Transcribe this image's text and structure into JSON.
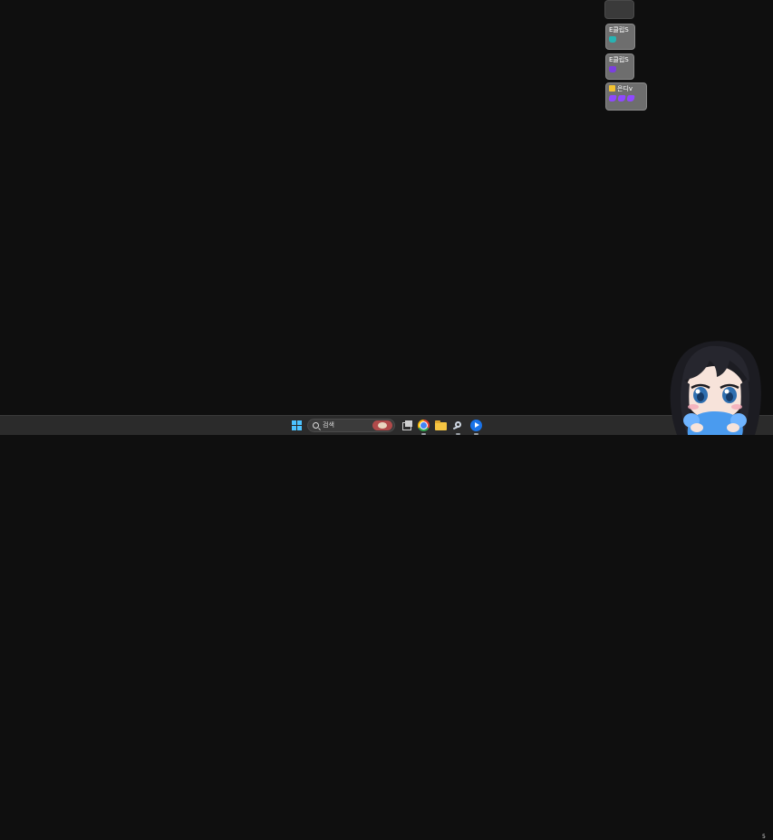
{
  "overlay": {
    "badges": [
      {
        "label": "",
        "gems": []
      },
      {
        "label": "E클립S",
        "gems": [
          "teal"
        ]
      },
      {
        "label": "E클립S",
        "gems": [
          "purple"
        ]
      },
      {
        "label": "은디v",
        "gems": [
          "violet",
          "violet",
          "violet"
        ]
      }
    ]
  },
  "taskbar": {
    "search": {
      "label": "검색"
    },
    "apps": [
      "task-view",
      "chrome",
      "file-explorer",
      "steam",
      "media-player"
    ],
    "clock": "5"
  },
  "colors": {
    "desktop": "#0f0f0f",
    "taskbar": "#2b2b2b",
    "badge": "#6e6e6e",
    "accent": "#4cc2ff"
  }
}
